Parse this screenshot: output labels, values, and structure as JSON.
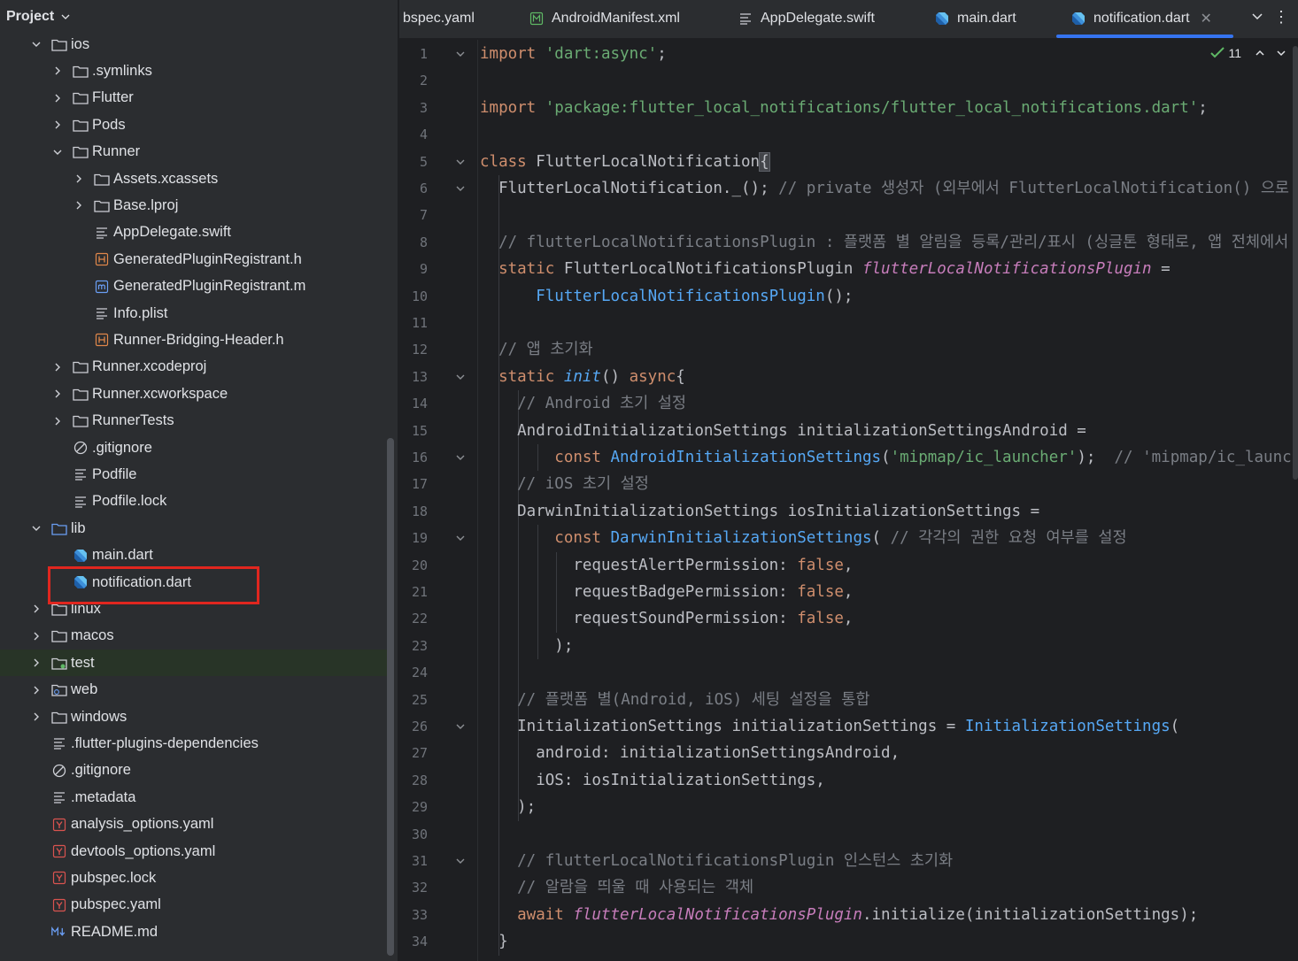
{
  "project_panel": {
    "title": "Project",
    "tree": [
      {
        "label": "ios",
        "indent": 0,
        "arrow": "down",
        "icon": "folder-icon"
      },
      {
        "label": ".symlinks",
        "indent": 1,
        "arrow": "right",
        "icon": "folder-icon"
      },
      {
        "label": "Flutter",
        "indent": 1,
        "arrow": "right",
        "icon": "folder-icon"
      },
      {
        "label": "Pods",
        "indent": 1,
        "arrow": "right",
        "icon": "folder-icon"
      },
      {
        "label": "Runner",
        "indent": 1,
        "arrow": "down",
        "icon": "folder-icon"
      },
      {
        "label": "Assets.xcassets",
        "indent": 2,
        "arrow": "right",
        "icon": "folder-icon"
      },
      {
        "label": "Base.lproj",
        "indent": 2,
        "arrow": "right",
        "icon": "folder-icon"
      },
      {
        "label": "AppDelegate.swift",
        "indent": 2,
        "arrow": "",
        "icon": "text-file-icon"
      },
      {
        "label": "GeneratedPluginRegistrant.h",
        "indent": 2,
        "arrow": "",
        "icon": "header-file-icon"
      },
      {
        "label": "GeneratedPluginRegistrant.m",
        "indent": 2,
        "arrow": "",
        "icon": "objc-file-icon"
      },
      {
        "label": "Info.plist",
        "indent": 2,
        "arrow": "",
        "icon": "text-file-icon"
      },
      {
        "label": "Runner-Bridging-Header.h",
        "indent": 2,
        "arrow": "",
        "icon": "header-file-icon"
      },
      {
        "label": "Runner.xcodeproj",
        "indent": 1,
        "arrow": "right",
        "icon": "folder-icon"
      },
      {
        "label": "Runner.xcworkspace",
        "indent": 1,
        "arrow": "right",
        "icon": "folder-icon"
      },
      {
        "label": "RunnerTests",
        "indent": 1,
        "arrow": "right",
        "icon": "folder-icon"
      },
      {
        "label": ".gitignore",
        "indent": 1,
        "arrow": "",
        "icon": "ignore-file-icon"
      },
      {
        "label": "Podfile",
        "indent": 1,
        "arrow": "",
        "icon": "text-file-icon"
      },
      {
        "label": "Podfile.lock",
        "indent": 1,
        "arrow": "",
        "icon": "text-file-icon"
      },
      {
        "label": "lib",
        "indent": 0,
        "arrow": "down",
        "icon": "source-folder-icon"
      },
      {
        "label": "main.dart",
        "indent": 1,
        "arrow": "",
        "icon": "dart-file-icon"
      },
      {
        "label": "notification.dart",
        "indent": 1,
        "arrow": "",
        "icon": "dart-file-icon",
        "selected": true
      },
      {
        "label": "linux",
        "indent": 0,
        "arrow": "right",
        "icon": "folder-icon"
      },
      {
        "label": "macos",
        "indent": 0,
        "arrow": "right",
        "icon": "folder-icon"
      },
      {
        "label": "test",
        "indent": 0,
        "arrow": "right",
        "icon": "test-folder-icon",
        "test": true
      },
      {
        "label": "web",
        "indent": 0,
        "arrow": "right",
        "icon": "web-folder-icon"
      },
      {
        "label": "windows",
        "indent": 0,
        "arrow": "right",
        "icon": "folder-icon"
      },
      {
        "label": ".flutter-plugins-dependencies",
        "indent": 0,
        "arrow": "",
        "icon": "text-file-icon"
      },
      {
        "label": ".gitignore",
        "indent": 0,
        "arrow": "",
        "icon": "ignore-file-icon"
      },
      {
        "label": ".metadata",
        "indent": 0,
        "arrow": "",
        "icon": "text-file-icon"
      },
      {
        "label": "analysis_options.yaml",
        "indent": 0,
        "arrow": "",
        "icon": "yaml-file-icon"
      },
      {
        "label": "devtools_options.yaml",
        "indent": 0,
        "arrow": "",
        "icon": "yaml-file-icon"
      },
      {
        "label": "pubspec.lock",
        "indent": 0,
        "arrow": "",
        "icon": "yaml-file-icon"
      },
      {
        "label": "pubspec.yaml",
        "indent": 0,
        "arrow": "",
        "icon": "yaml-file-icon"
      },
      {
        "label": "README.md",
        "indent": 0,
        "arrow": "",
        "icon": "markdown-file-icon"
      }
    ]
  },
  "tabs": [
    {
      "label": "bspec.yaml",
      "icon": "",
      "active": false
    },
    {
      "label": "AndroidManifest.xml",
      "icon": "manifest-file-icon",
      "active": false
    },
    {
      "label": "AppDelegate.swift",
      "icon": "text-file-icon",
      "active": false
    },
    {
      "label": "main.dart",
      "icon": "dart-file-icon",
      "active": false
    },
    {
      "label": "notification.dart",
      "icon": "dart-file-icon",
      "active": true
    }
  ],
  "inspection": {
    "count": "11"
  },
  "colors": {
    "accent": "#3574f0",
    "highlight_box": "#e0261f",
    "keyword": "#cf8e6d",
    "string": "#6aab73",
    "comment": "#7a7e85",
    "function": "#56a8f5",
    "field": "#c77dbb"
  },
  "code": {
    "line_numbers": [
      "1",
      "2",
      "3",
      "4",
      "5",
      "6",
      "7",
      "8",
      "9",
      "10",
      "11",
      "12",
      "13",
      "14",
      "15",
      "16",
      "17",
      "18",
      "19",
      "20",
      "21",
      "22",
      "23",
      "24",
      "25",
      "26",
      "27",
      "28",
      "29",
      "30",
      "31",
      "32",
      "33",
      "34"
    ],
    "fold_lines": [
      1,
      5,
      6,
      13,
      16,
      19,
      26,
      31
    ],
    "lines": [
      [
        {
          "t": "kw",
          "v": "import "
        },
        {
          "t": "str",
          "v": "'dart:async'"
        },
        {
          "t": "",
          "v": ";"
        }
      ],
      [],
      [
        {
          "t": "kw",
          "v": "import "
        },
        {
          "t": "str",
          "v": "'package:flutter_local_notifications/flutter_local_notifications.dart'"
        },
        {
          "t": "",
          "v": ";"
        }
      ],
      [],
      [
        {
          "t": "kw",
          "v": "class "
        },
        {
          "t": "",
          "v": "FlutterLocalNotification"
        },
        {
          "t": "brace",
          "v": "{"
        }
      ],
      [
        {
          "t": "",
          "v": "  FlutterLocalNotification._(); "
        },
        {
          "t": "cmt",
          "v": "// private 생성자 (외부에서 FlutterLocalNotification() 으로"
        }
      ],
      [],
      [
        {
          "t": "cmt",
          "v": "  // flutterLocalNotificationsPlugin : 플랫폼 별 알림을 등록/관리/표시 (싱글톤 형태로, 앱 전체에서 하"
        }
      ],
      [
        {
          "t": "kw",
          "v": "  static "
        },
        {
          "t": "",
          "v": "FlutterLocalNotificationsPlugin "
        },
        {
          "t": "ital",
          "v": "flutterLocalNotificationsPlugin"
        },
        {
          "t": "",
          "v": " ="
        }
      ],
      [
        {
          "t": "",
          "v": "      "
        },
        {
          "t": "fn",
          "v": "FlutterLocalNotificationsPlugin"
        },
        {
          "t": "",
          "v": "();"
        }
      ],
      [],
      [
        {
          "t": "cmt",
          "v": "  // 앱 초기화"
        }
      ],
      [
        {
          "t": "kw",
          "v": "  static "
        },
        {
          "t": "fnit",
          "v": "init"
        },
        {
          "t": "",
          "v": "() "
        },
        {
          "t": "kw",
          "v": "async"
        },
        {
          "t": "",
          "v": "{"
        }
      ],
      [
        {
          "t": "cmt",
          "v": "    // Android 초기 설정"
        }
      ],
      [
        {
          "t": "",
          "v": "    AndroidInitializationSettings initializationSettingsAndroid ="
        }
      ],
      [
        {
          "t": "kw",
          "v": "        const "
        },
        {
          "t": "fn",
          "v": "AndroidInitializationSettings"
        },
        {
          "t": "",
          "v": "("
        },
        {
          "t": "str",
          "v": "'mipmap/ic_launcher'"
        },
        {
          "t": "",
          "v": ");  "
        },
        {
          "t": "cmt",
          "v": "// 'mipmap/ic_launc"
        }
      ],
      [
        {
          "t": "cmt",
          "v": "    // iOS 초기 설정"
        }
      ],
      [
        {
          "t": "",
          "v": "    DarwinInitializationSettings iosInitializationSettings ="
        }
      ],
      [
        {
          "t": "kw",
          "v": "        const "
        },
        {
          "t": "fn",
          "v": "DarwinInitializationSettings"
        },
        {
          "t": "",
          "v": "( "
        },
        {
          "t": "cmt",
          "v": "// 각각의 권한 요청 여부를 설정"
        }
      ],
      [
        {
          "t": "",
          "v": "          requestAlertPermission: "
        },
        {
          "t": "kw",
          "v": "false"
        },
        {
          "t": "",
          "v": ","
        }
      ],
      [
        {
          "t": "",
          "v": "          requestBadgePermission: "
        },
        {
          "t": "kw",
          "v": "false"
        },
        {
          "t": "",
          "v": ","
        }
      ],
      [
        {
          "t": "",
          "v": "          requestSoundPermission: "
        },
        {
          "t": "kw",
          "v": "false"
        },
        {
          "t": "",
          "v": ","
        }
      ],
      [
        {
          "t": "",
          "v": "        );"
        }
      ],
      [],
      [
        {
          "t": "cmt",
          "v": "    // 플랫폼 별(Android, iOS) 세팅 설정을 통합"
        }
      ],
      [
        {
          "t": "",
          "v": "    InitializationSettings initializationSettings = "
        },
        {
          "t": "fn",
          "v": "InitializationSettings"
        },
        {
          "t": "",
          "v": "("
        }
      ],
      [
        {
          "t": "",
          "v": "      android: initializationSettingsAndroid,"
        }
      ],
      [
        {
          "t": "",
          "v": "      iOS: iosInitializationSettings,"
        }
      ],
      [
        {
          "t": "",
          "v": "    );"
        }
      ],
      [],
      [
        {
          "t": "cmt",
          "v": "    // flutterLocalNotificationsPlugin 인스턴스 초기화"
        }
      ],
      [
        {
          "t": "cmt",
          "v": "    // 알람을 띄울 때 사용되는 객체"
        }
      ],
      [
        {
          "t": "kw",
          "v": "    await "
        },
        {
          "t": "ital",
          "v": "flutterLocalNotificationsPlugin"
        },
        {
          "t": "",
          "v": ".initialize(initializationSettings);"
        }
      ],
      [
        {
          "t": "",
          "v": "  }"
        }
      ]
    ]
  }
}
